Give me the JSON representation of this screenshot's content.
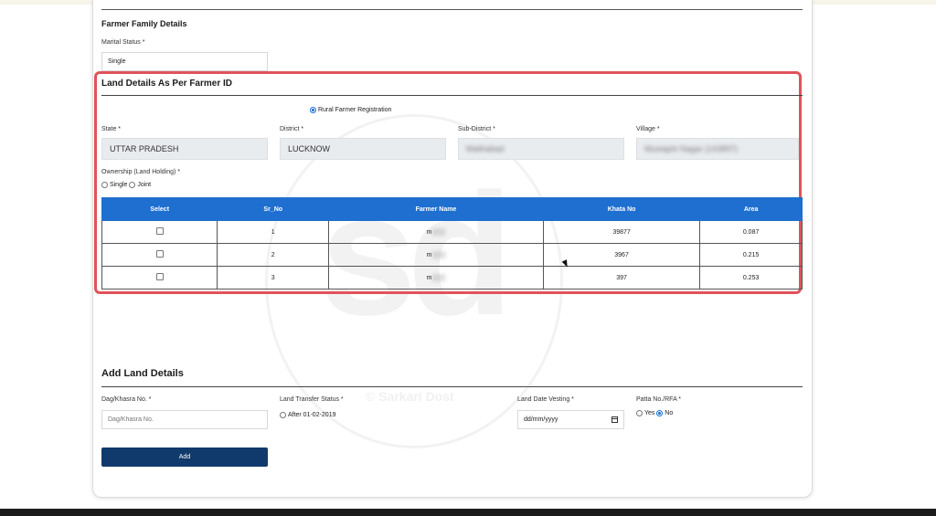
{
  "family": {
    "title": "Farmer Family Details",
    "marital_label": "Marital Status *",
    "marital_value": "Single"
  },
  "land_as_per_id": {
    "title": "Land Details As Per Farmer ID",
    "registration_option": "Rural Farmer Registration",
    "state_label": "State *",
    "state_value": "UTTAR PRADESH",
    "district_label": "District *",
    "district_value": "LUCKNOW",
    "subdistrict_label": "Sub-District *",
    "subdistrict_value": "Malihabad",
    "village_label": "Village *",
    "village_value": "Mustaphi Nagar (143897)",
    "ownership_label": "Ownership (Land Holding) *",
    "ownership_single": "Single",
    "ownership_joint": "Joint",
    "table": {
      "headers": [
        "Select",
        "Sr_No",
        "Farmer Name",
        "Khata No",
        "Area"
      ],
      "rows": [
        {
          "sr": "1",
          "name": "m",
          "khata": "39877",
          "area": "0.087"
        },
        {
          "sr": "2",
          "name": "m",
          "khata": "3967",
          "area": "0.215"
        },
        {
          "sr": "3",
          "name": "m",
          "khata": "397",
          "area": "0.253"
        }
      ]
    }
  },
  "add_land": {
    "title": "Add Land Details",
    "khasra_label": "Dag/Khasra No. *",
    "khasra_placeholder": "Dag/Khasra No.",
    "transfer_label": "Land Transfer Status *",
    "transfer_option": "After 01-02-2019",
    "vesting_label": "Land Date Vesting *",
    "vesting_value": "dd/mm/yyyy",
    "patta_label": "Patta No./RFA *",
    "patta_yes": "Yes",
    "patta_no": "No",
    "add_button": "Add"
  },
  "watermark": {
    "mark": "sd",
    "brand": "Sarkari Dost"
  },
  "colors": {
    "table_header": "#1f6fd0",
    "highlight_border": "#e0535c",
    "add_button": "#103a6b"
  }
}
